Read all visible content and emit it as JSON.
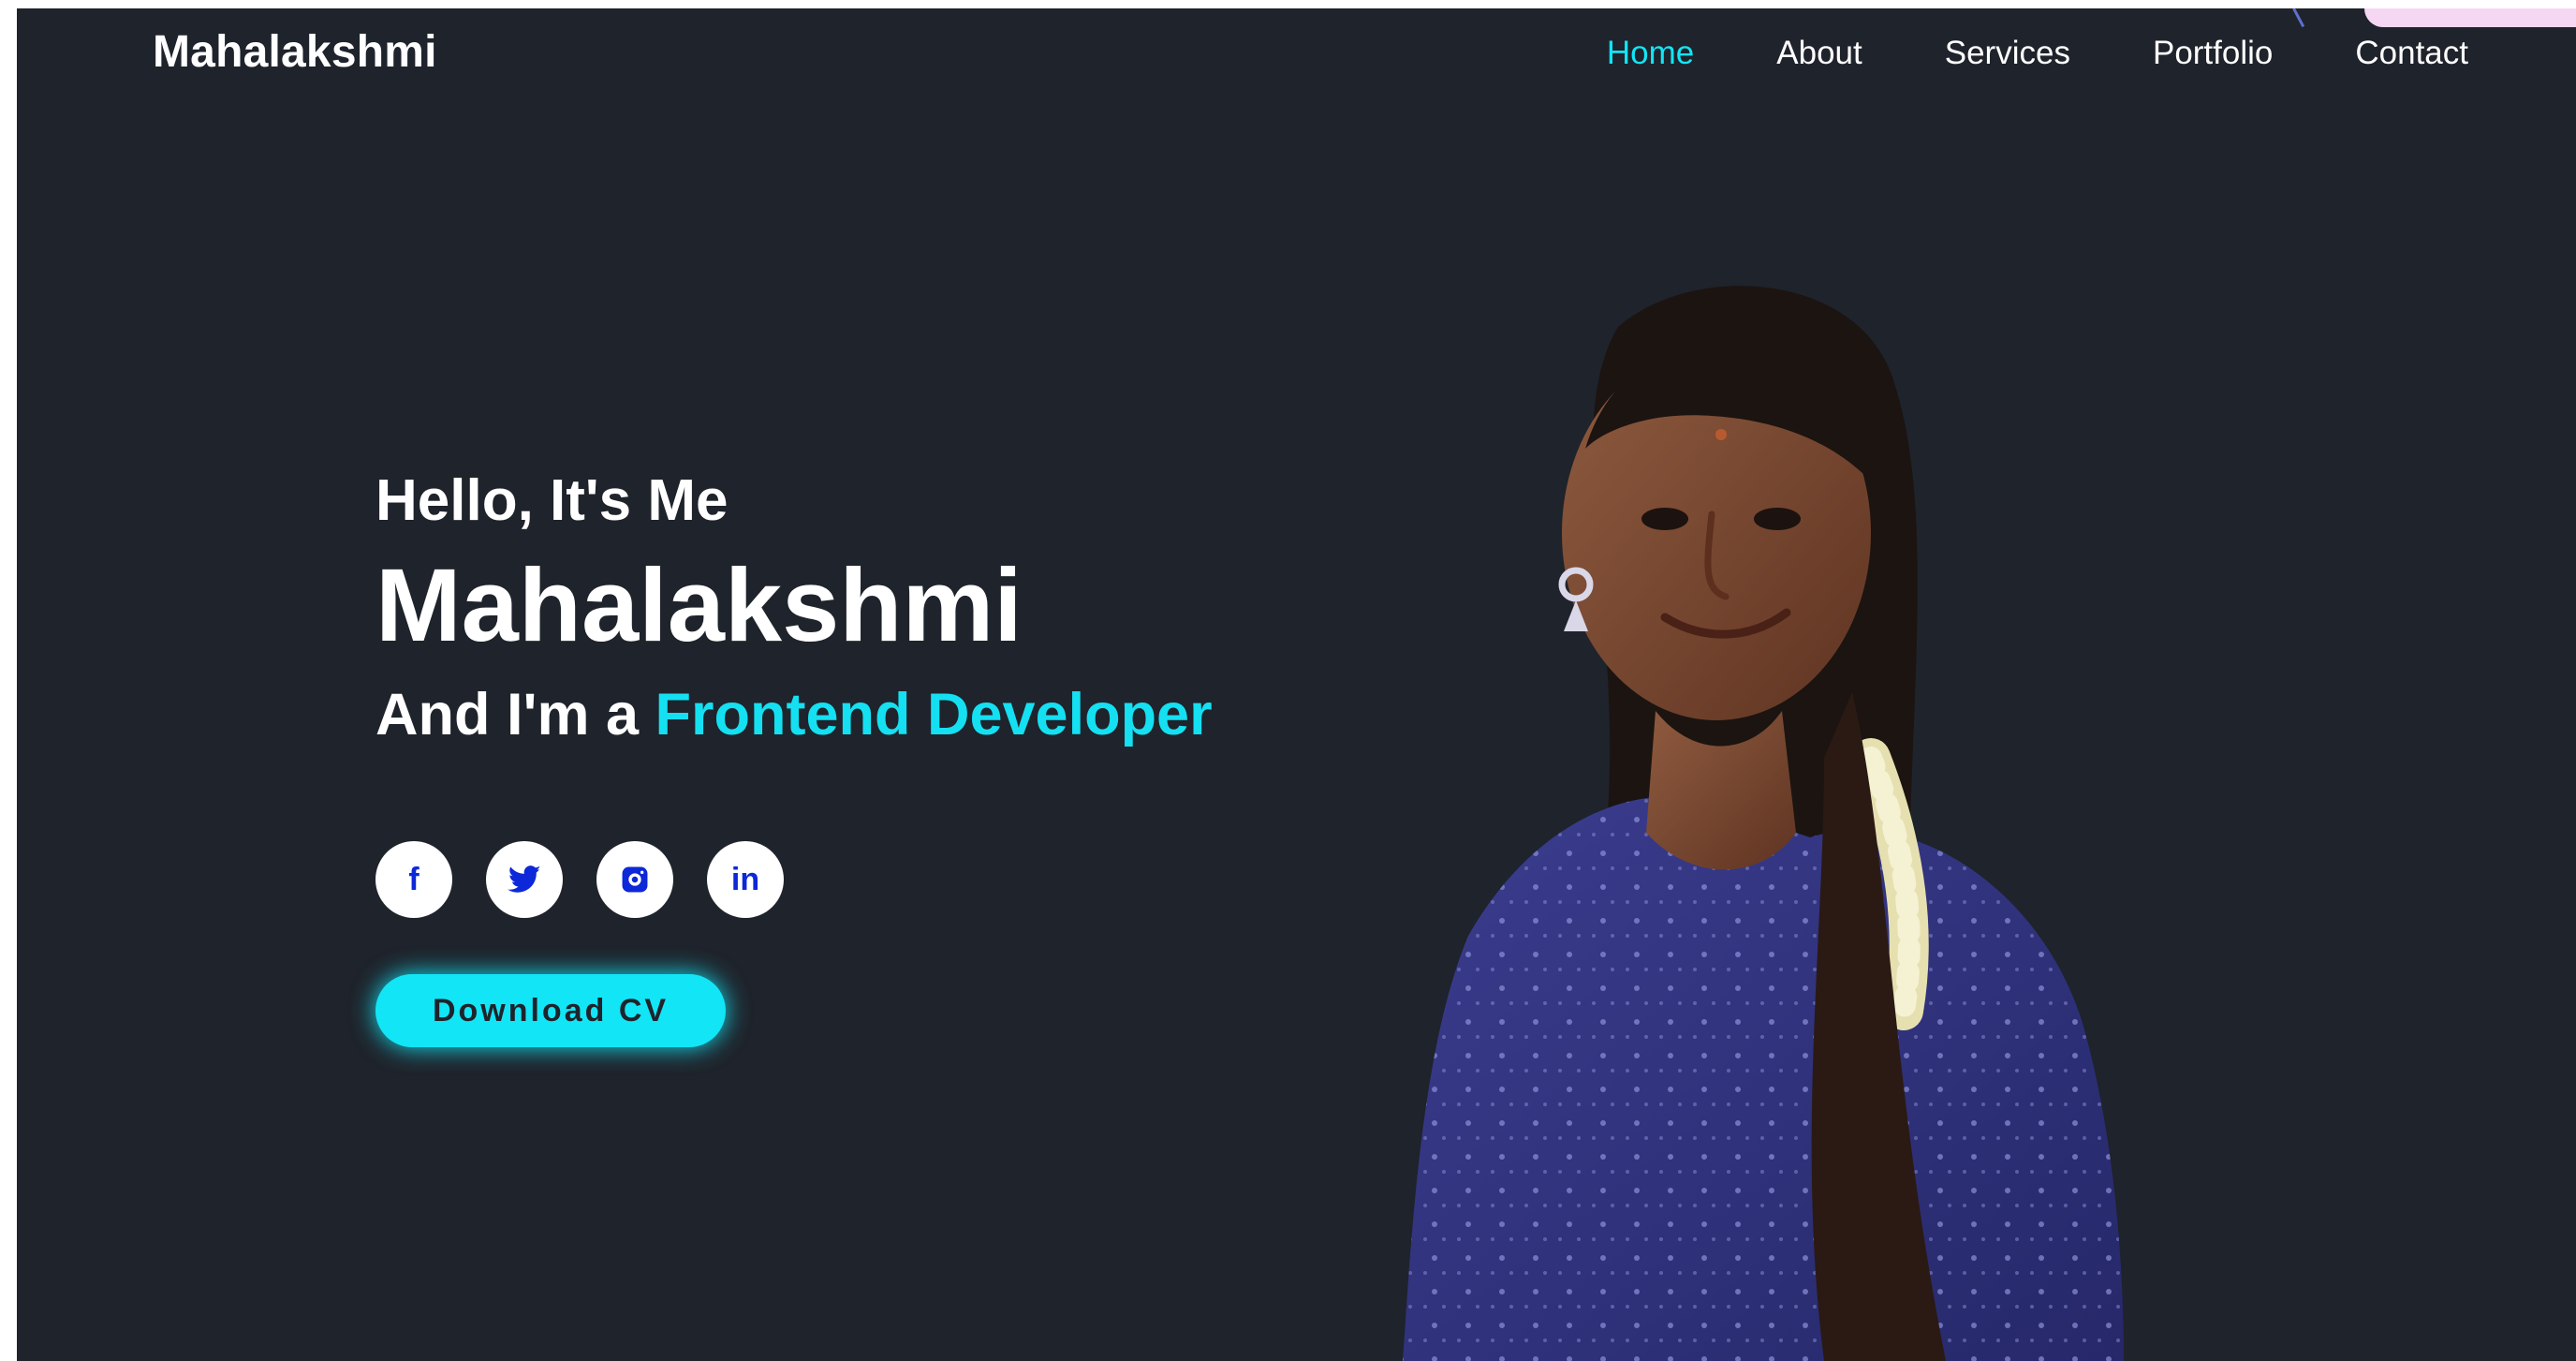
{
  "brand": {
    "name": "Mahalakshmi"
  },
  "nav": {
    "items": [
      {
        "label": "Home",
        "active": true
      },
      {
        "label": "About",
        "active": false
      },
      {
        "label": "Services",
        "active": false
      },
      {
        "label": "Portfolio",
        "active": false
      },
      {
        "label": "Contact",
        "active": false
      }
    ]
  },
  "hero": {
    "greeting": "Hello, It's Me",
    "name": "Mahalakshmi",
    "role_prefix": "And I'm a ",
    "role_highlight": "Frontend Developer",
    "social": [
      {
        "name": "facebook-icon",
        "glyph": "f"
      },
      {
        "name": "twitter-icon",
        "glyph": "🐦"
      },
      {
        "name": "instagram-icon",
        "glyph": "◉"
      },
      {
        "name": "linkedin-icon",
        "glyph": "in"
      }
    ],
    "cta_label": "Download CV"
  },
  "colors": {
    "background": "#1f232b",
    "accent": "#12e5f6",
    "text": "#ffffff",
    "icon": "#0c28d8"
  }
}
